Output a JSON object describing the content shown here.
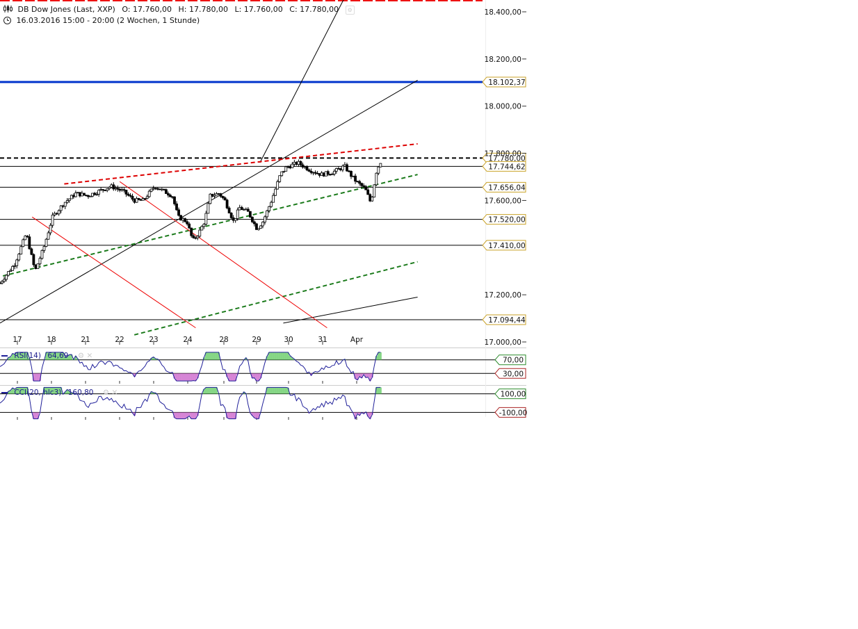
{
  "header": {
    "instrument": "DB Dow Jones (Last, XXP)",
    "open": "O: 17.760,00",
    "high": "H: 17.780,00",
    "low": "L: 17.760,00",
    "close": "C: 17.780,00",
    "period": "16.03.2016 15:00 - 20:00 (2 Wochen, 1 Stunde)"
  },
  "indicators": {
    "rsi": {
      "label": "RSI(14)",
      "value": "64,69",
      "upper": "70,00",
      "lower": "30,00"
    },
    "cci": {
      "label": "CCI(20, hlc3)",
      "value": "160,80",
      "upper": "100,00",
      "lower": "-100,00"
    }
  },
  "chart_data": {
    "type": "candlestick",
    "title": "DB Dow Jones (Last, XXP)",
    "interval": "1 hour",
    "x_tick_labels": [
      "17",
      "18",
      "21",
      "22",
      "23",
      "24",
      "28",
      "29",
      "30",
      "31",
      "Apr"
    ],
    "y_tick_labels": [
      "18.400,00",
      "18.200,00",
      "18.000,00",
      "17.800,00",
      "17.600,00",
      "17.200,00",
      "17.000,00"
    ],
    "y_ticks": [
      18400,
      18200,
      18000,
      17800,
      17600,
      17200,
      17000
    ],
    "ylim": [
      16975,
      18450
    ],
    "price_path": [
      [
        0,
        17250
      ],
      [
        0.5,
        17330
      ],
      [
        0.9,
        17460
      ],
      [
        1.2,
        17300
      ],
      [
        1.5,
        17400
      ],
      [
        1.8,
        17530
      ],
      [
        2.2,
        17590
      ],
      [
        2.6,
        17630
      ],
      [
        3.0,
        17620
      ],
      [
        3.4,
        17640
      ],
      [
        3.8,
        17660
      ],
      [
        4.2,
        17640
      ],
      [
        4.6,
        17600
      ],
      [
        4.9,
        17600
      ],
      [
        5.3,
        17660
      ],
      [
        5.6,
        17640
      ],
      [
        5.9,
        17620
      ],
      [
        6.1,
        17530
      ],
      [
        6.4,
        17510
      ],
      [
        6.6,
        17430
      ],
      [
        6.8,
        17460
      ],
      [
        7.0,
        17510
      ],
      [
        7.2,
        17620
      ],
      [
        7.5,
        17630
      ],
      [
        7.7,
        17600
      ],
      [
        8.0,
        17510
      ],
      [
        8.2,
        17570
      ],
      [
        8.5,
        17550
      ],
      [
        8.8,
        17480
      ],
      [
        9.0,
        17510
      ],
      [
        9.3,
        17600
      ],
      [
        9.6,
        17710
      ],
      [
        9.8,
        17740
      ],
      [
        10.2,
        17760
      ],
      [
        10.6,
        17730
      ],
      [
        11.0,
        17710
      ],
      [
        11.4,
        17720
      ],
      [
        11.8,
        17745
      ],
      [
        12.0,
        17710
      ],
      [
        12.2,
        17680
      ],
      [
        12.5,
        17650
      ],
      [
        12.7,
        17590
      ],
      [
        12.9,
        17730
      ],
      [
        13.1,
        17780
      ]
    ],
    "horizontal_levels": [
      {
        "value": 18102.37,
        "label": "18.102,37",
        "style": "solid-blue",
        "color": "#0033cc"
      },
      {
        "value": 17780.0,
        "label": "17.780,00",
        "style": "dashed-black",
        "color": "#000000"
      },
      {
        "value": 17744.62,
        "label": "17.744,62",
        "style": "solid-black",
        "color": "#000000"
      },
      {
        "value": 17656.04,
        "label": "17.656,04",
        "style": "solid-black",
        "color": "#000000"
      },
      {
        "value": 17520.0,
        "label": "17.520,00",
        "style": "solid-black",
        "color": "#000000"
      },
      {
        "value": 17410.0,
        "label": "17.410,00",
        "style": "solid-black",
        "color": "#000000"
      },
      {
        "value": 17094.44,
        "label": "17.094,44",
        "style": "solid-black",
        "color": "#000000"
      }
    ],
    "trend_lines": [
      {
        "from": [
          0,
          17080
        ],
        "to": [
          14.3,
          18110
        ],
        "color": "#000000",
        "style": "solid"
      },
      {
        "from": [
          8.9,
          17760
        ],
        "to": [
          11.8,
          18460
        ],
        "color": "#000000",
        "style": "solid"
      },
      {
        "from": [
          9.7,
          17080
        ],
        "to": [
          14.3,
          17190
        ],
        "color": "#000000",
        "style": "solid"
      },
      {
        "from": [
          2.2,
          17670
        ],
        "to": [
          14.3,
          17840
        ],
        "color": "#dd0000",
        "style": "dashed"
      },
      {
        "from": [
          0.1,
          17280
        ],
        "to": [
          14.3,
          17710
        ],
        "color": "#1a7a1a",
        "style": "dashed"
      },
      {
        "from": [
          4.6,
          17030
        ],
        "to": [
          14.3,
          17340
        ],
        "color": "#1a7a1a",
        "style": "dashed"
      },
      {
        "from": [
          1.1,
          17530
        ],
        "to": [
          6.7,
          17060
        ],
        "color": "#ee0000",
        "style": "solid"
      },
      {
        "from": [
          4.1,
          17680
        ],
        "to": [
          11.2,
          17060
        ],
        "color": "#ee0000",
        "style": "solid"
      }
    ]
  },
  "colors": {
    "rsi_line": "#1f1f99",
    "cci_line": "#1f1f99",
    "overbought_fill": "#66cc66",
    "oversold_fill": "#cc66cc",
    "label_box_border": "#c9a227",
    "rsi_upper_border": "#2a8a2a",
    "rsi_lower_border": "#aa2222"
  }
}
